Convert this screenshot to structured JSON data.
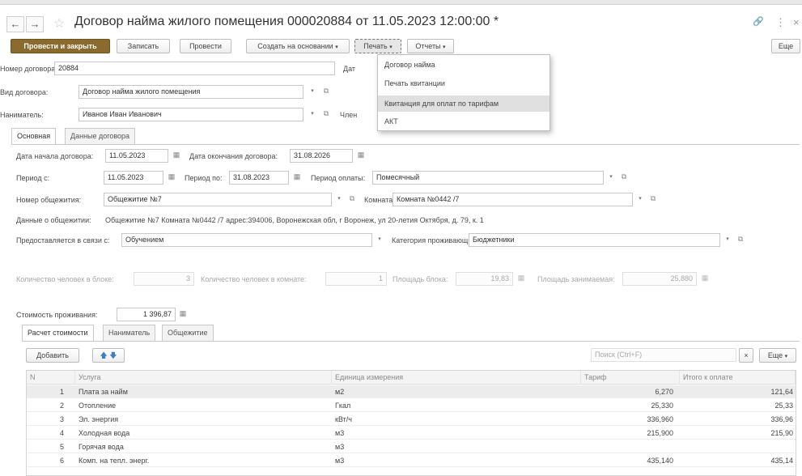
{
  "window": {
    "title": "Договор найма жилого помещения 000020884 от 11.05.2023 12:00:00 *",
    "back_glyph": "←",
    "forward_glyph": "→",
    "star_glyph": "☆",
    "link_glyph": "🔗",
    "more_glyph": "⋮",
    "close_glyph": "×"
  },
  "toolbar": {
    "post_close": "Провести и закрыть",
    "write": "Записать",
    "post": "Провести",
    "create_based": "Создать на основании",
    "print": "Печать",
    "reports": "Отчеты",
    "more": "Еще",
    "arrow": "▾"
  },
  "print_menu": {
    "items": [
      "Договор найма",
      "Печать квитанции",
      "Квитанция для оплат по тарифам",
      "АКТ"
    ],
    "highlighted_index": 2
  },
  "header_form": {
    "contract_no_label": "Номер договора:",
    "contract_no": "20884",
    "date_label_partial": "Дат",
    "contract_type_label": "Вид договора:",
    "contract_type": "Договор найма жилого помещения",
    "tenant_label": "Наниматель:",
    "tenant": "Иванов Иван Иванович",
    "members_label_partial": "Член"
  },
  "main_tabs": [
    "Основная",
    "Данные договора"
  ],
  "main": {
    "start_label": "Дата начала договора:",
    "start": "11.05.2023",
    "end_label": "Дата окончания договора:",
    "end": "31.08.2026",
    "period_from_label": "Период с:",
    "period_from": "11.05.2023",
    "period_to_label": "Период по:",
    "period_to": "31.08.2023",
    "pay_period_label": "Период оплаты:",
    "pay_period": "Помесячный",
    "dorm_label": "Номер общежития:",
    "dorm": "Общежитие №7",
    "room_label": "Комната:",
    "room": "Комната №0442 /7",
    "dorm_info_label": "Данные о общежитии:",
    "dorm_info": "Общежитие №7 Комната №0442 /7 адрес:394006, Воронежская обл, г Воронеж, ул 20-летия Октября, д. 79, к. 1",
    "reason_label": "Предоставляется в связи с:",
    "reason": "Обучением",
    "category_label": "Категория проживающих:",
    "category": "Бюджетники",
    "block_people_label": "Количество человек в блоке:",
    "block_people": "3",
    "room_people_label": "Количество человек в комнате:",
    "room_people": "1",
    "block_area_label": "Площадь блока:",
    "block_area": "19,83",
    "occupied_area_label": "Площадь занимаемая:",
    "occupied_area": "25,880",
    "cost_label": "Стоимость проживания:",
    "cost": "1 396,87"
  },
  "sub_tabs": [
    "Расчет стоимости",
    "Наниматель",
    "Общежитие"
  ],
  "table_toolbar": {
    "add": "Добавить",
    "up": "🡅",
    "down": "🡇",
    "search_placeholder": "Поиск (Ctrl+F)",
    "clear": "×",
    "more": "Еще"
  },
  "table": {
    "columns": [
      "N",
      "Услуга",
      "Единица измерения",
      "Тариф",
      "Итого к оплате"
    ],
    "rows": [
      {
        "n": "1",
        "service": "Плата за найм",
        "unit": "м2",
        "tariff": "6,270",
        "total": "121,64"
      },
      {
        "n": "2",
        "service": "Отопление",
        "unit": "Гкал",
        "tariff": "25,330",
        "total": "25,33"
      },
      {
        "n": "3",
        "service": "Эл. энергия",
        "unit": "кВт/ч",
        "tariff": "336,960",
        "total": "336,96"
      },
      {
        "n": "4",
        "service": "Холодная вода",
        "unit": "м3",
        "tariff": "215,900",
        "total": "215,90"
      },
      {
        "n": "5",
        "service": "Горячая вода",
        "unit": "м3",
        "tariff": "",
        "total": ""
      },
      {
        "n": "6",
        "service": "Комп. на тепл. энерг.",
        "unit": "м3",
        "tariff": "435,140",
        "total": "435,14"
      }
    ]
  }
}
